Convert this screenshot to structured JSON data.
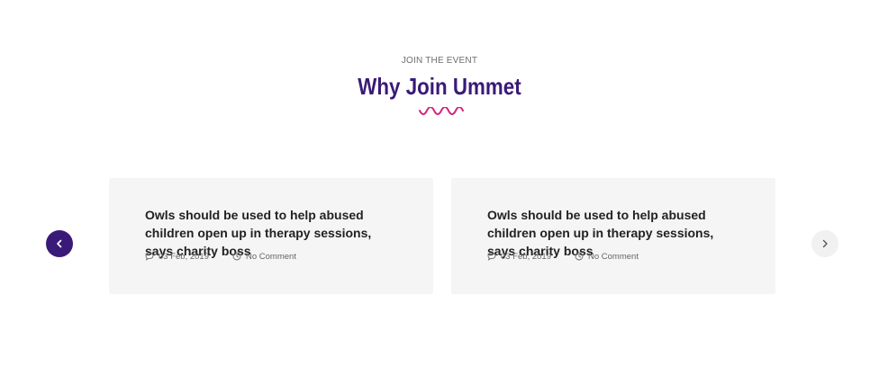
{
  "header": {
    "eyebrow": "JOIN THE EVENT",
    "title": "Why Join Ummet"
  },
  "colors": {
    "accent_purple": "#3a1a78",
    "accent_pink": "#d4257a",
    "card_bg": "#f5f5f5"
  },
  "carousel": {
    "prev_icon": "chevron-left-icon",
    "next_icon": "chevron-right-icon",
    "cards": [
      {
        "title": "Owls should be used to help abused children open up in therapy sessions, says charity boss",
        "date": "03 Feb, 2019",
        "comments": "No Comment",
        "date_icon": "chat-bubble-icon",
        "comments_icon": "clock-icon"
      },
      {
        "title": "Owls should be used to help abused children open up in therapy sessions, says charity boss",
        "date": "03 Feb, 2019",
        "comments": "No Comment",
        "date_icon": "chat-bubble-icon",
        "comments_icon": "clock-icon"
      }
    ]
  }
}
